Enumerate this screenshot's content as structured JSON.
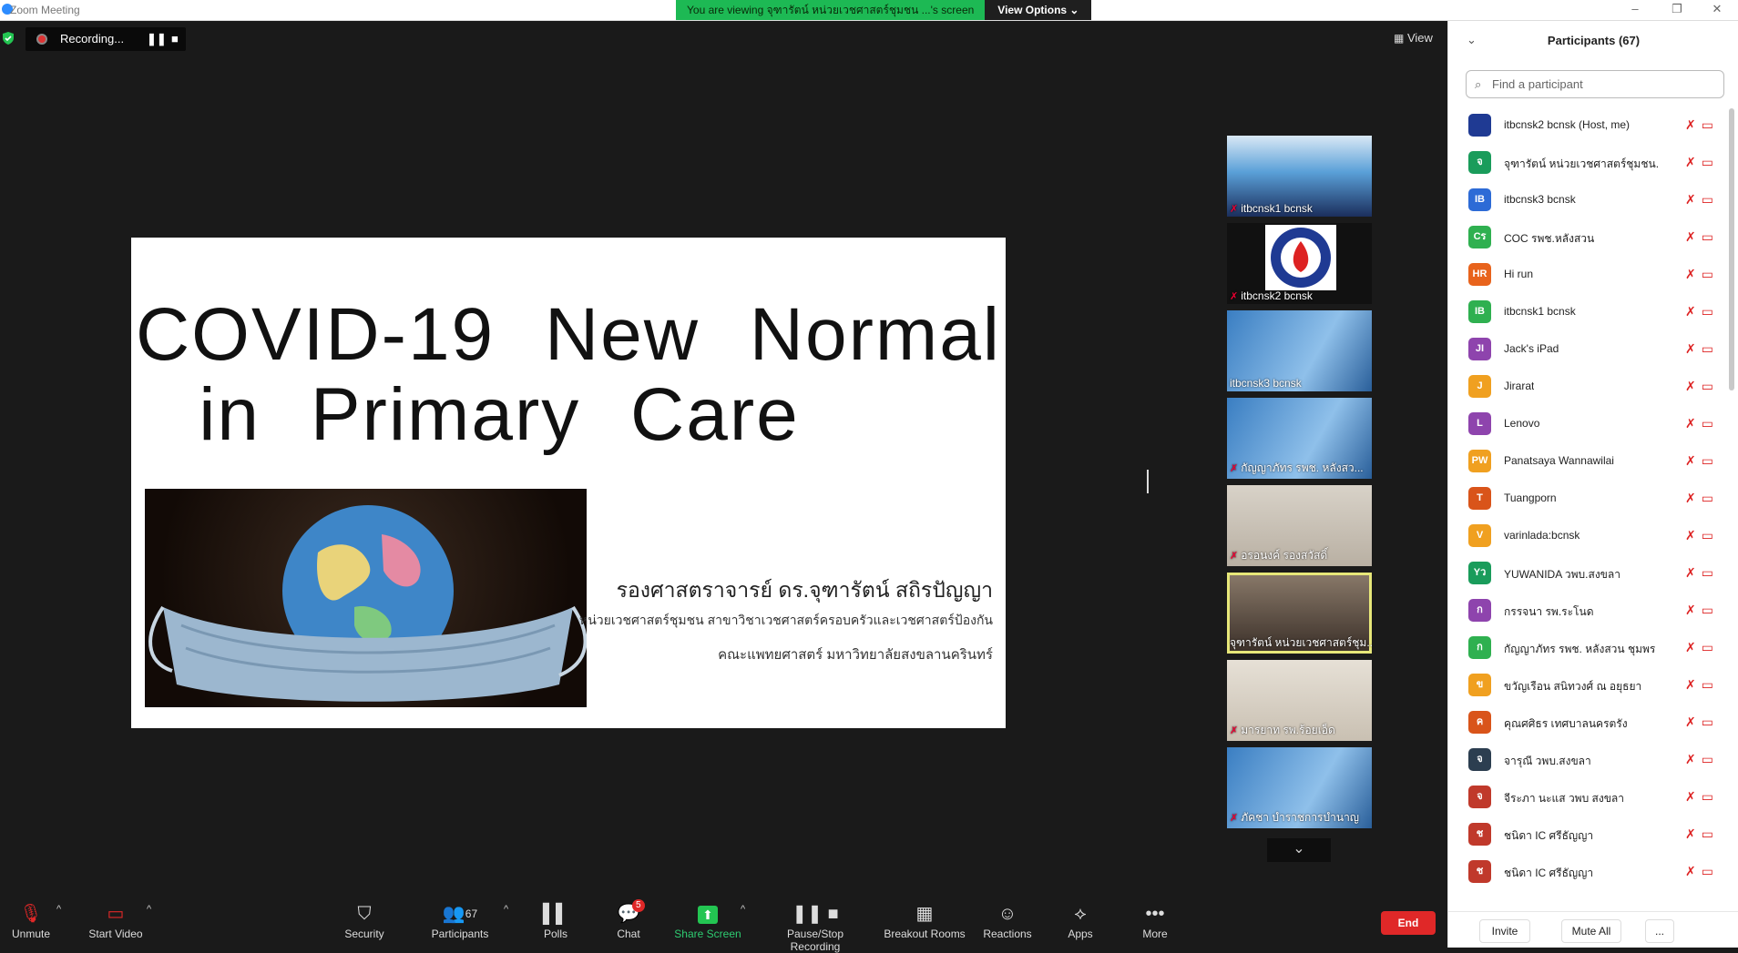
{
  "window": {
    "title": "Zoom Meeting",
    "minimize": "–",
    "restore": "❐",
    "close": "✕"
  },
  "viewing_banner": {
    "text": "You are viewing จุฑารัตน์ หน่วยเวชศาสตร์ชุมชน ...'s screen",
    "options_label": "View Options ⌄"
  },
  "recording": {
    "label": "Recording...",
    "pause": "❚❚",
    "stop": "■"
  },
  "view_button": {
    "label": "View"
  },
  "slide": {
    "title_line1": "COVID-19  New  Normal",
    "title_line2": "in  Primary  Care",
    "author": "รองศาสตราจารย์  ดร.จุฑารัตน์  สถิรปัญญา",
    "affiliation1": "หน่วยเวชศาสตร์ชุมชน  สาขาวิชาเวชศาสตร์ครอบครัวและเวชศาสตร์ป้องกัน",
    "affiliation2": "คณะแพทยศาสตร์  มหาวิทยาลัยสงขลานครินทร์"
  },
  "thumbnails": [
    {
      "label": "itbcnsk1 bcnsk"
    },
    {
      "label": "itbcnsk2 bcnsk"
    },
    {
      "label": "itbcnsk3 bcnsk"
    },
    {
      "label": "กัญญาภัทร รพช. หลังสว..."
    },
    {
      "label": "อรอนงค์ รองสวัสดิ์"
    },
    {
      "label": "จุฑารัตน์ หน่วยเวชศาสตร์ชุม..."
    },
    {
      "label": "มารยาท รพ.ร้อยเอ็ด"
    },
    {
      "label": "ภัคชา  บำราชการบำนาญ"
    }
  ],
  "toolbar": {
    "unmute": "Unmute",
    "start_video": "Start Video",
    "security": "Security",
    "participants": "Participants",
    "participants_count": "67",
    "polls": "Polls",
    "chat": "Chat",
    "chat_badge": "5",
    "share_screen": "Share Screen",
    "recording": "Pause/Stop Recording",
    "breakout": "Breakout Rooms",
    "reactions": "Reactions",
    "apps": "Apps",
    "more": "More",
    "end": "End"
  },
  "panel": {
    "title": "Participants (67)",
    "search_placeholder": "Find a participant",
    "invite": "Invite",
    "mute_all": "Mute All",
    "more": "...",
    "participants": [
      {
        "initials": "",
        "name": "itbcnsk2 bcnsk (Host, me)",
        "color": "#1f3a93"
      },
      {
        "initials": "จ",
        "name": "จุฑารัตน์ หน่วยเวชศาสตร์ชุมชน...",
        "color": "#1a9c5b"
      },
      {
        "initials": "IB",
        "name": "itbcnsk3 bcnsk",
        "color": "#2d6bd6"
      },
      {
        "initials": "Cร",
        "name": "COC รพช.หลังสวน",
        "color": "#2fb050"
      },
      {
        "initials": "HR",
        "name": "Hi run",
        "color": "#e8631c"
      },
      {
        "initials": "IB",
        "name": "itbcnsk1 bcnsk",
        "color": "#2fb050"
      },
      {
        "initials": "JI",
        "name": "Jack's iPad",
        "color": "#8e44ad"
      },
      {
        "initials": "J",
        "name": "Jirarat",
        "color": "#f0a020"
      },
      {
        "initials": "L",
        "name": "Lenovo",
        "color": "#8e44ad"
      },
      {
        "initials": "PW",
        "name": "Panatsaya Wannawilai",
        "color": "#f0a020"
      },
      {
        "initials": "T",
        "name": "Tuangporn",
        "color": "#d9541a"
      },
      {
        "initials": "V",
        "name": "varinlada:bcnsk",
        "color": "#f0a020"
      },
      {
        "initials": "Yว",
        "name": "YUWANIDA วพบ.สงขลา",
        "color": "#1a9c5b"
      },
      {
        "initials": "ก",
        "name": "กรรจนา รพ.ระโนด",
        "color": "#8e44ad"
      },
      {
        "initials": "ก",
        "name": "กัญญาภัทร รพช. หลังสวน ชุมพร",
        "color": "#2fb050"
      },
      {
        "initials": "ข",
        "name": "ขวัญเรือน สนิทวงศ์ ณ อยุธยา",
        "color": "#f0a020"
      },
      {
        "initials": "ค",
        "name": "คุณศศิธร เทศบาลนครตรัง",
        "color": "#d9541a"
      },
      {
        "initials": "จ",
        "name": "จารุณี วพบ.สงขลา",
        "color": "#2c3e50"
      },
      {
        "initials": "จ",
        "name": "จีระภา  นะแส  วพบ สงขลา",
        "color": "#c0392b"
      },
      {
        "initials": "ช",
        "name": "ชนิดา IC ศรีธัญญา",
        "color": "#c0392b"
      },
      {
        "initials": "ช",
        "name": "ชนิดา IC ศรีธัญญา",
        "color": "#c0392b"
      }
    ]
  }
}
